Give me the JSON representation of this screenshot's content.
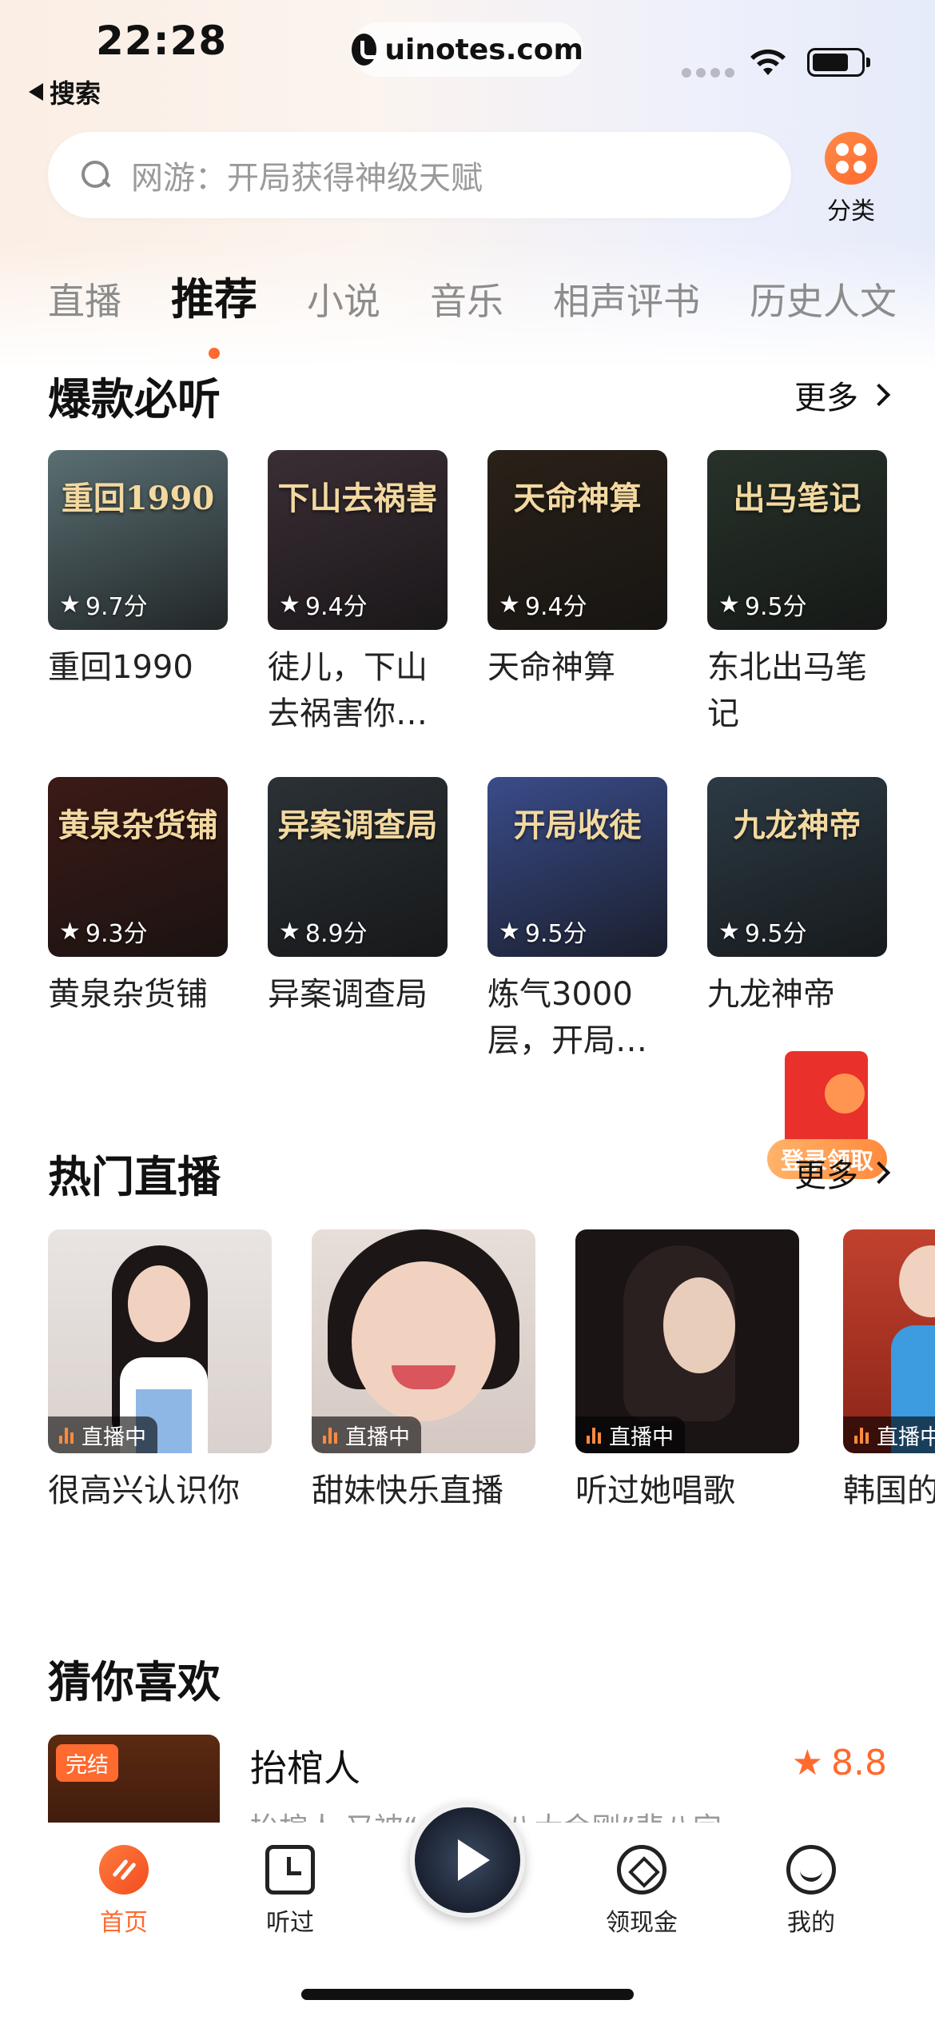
{
  "status_bar": {
    "time": "22:28",
    "back_label": "搜索",
    "url": "uinotes.com"
  },
  "search": {
    "placeholder": "网游：开局获得神级天赋"
  },
  "category": {
    "label": "分类"
  },
  "tabs": [
    {
      "label": "直播",
      "active": false
    },
    {
      "label": "推荐",
      "active": true
    },
    {
      "label": "小说",
      "active": false
    },
    {
      "label": "音乐",
      "active": false
    },
    {
      "label": "相声评书",
      "active": false
    },
    {
      "label": "历史人文",
      "active": false
    }
  ],
  "hot_section": {
    "title": "爆款必听",
    "more": "更多",
    "books": [
      {
        "title": "重回1990",
        "rating": "9.7分",
        "cover_text": "重回1990",
        "color": "#5a6f73"
      },
      {
        "title": "徒儿，下山去祸害你…",
        "rating": "9.4分",
        "cover_text": "下山去祸害",
        "color": "#3a2e35"
      },
      {
        "title": "天命神算",
        "rating": "9.4分",
        "cover_text": "天命神算",
        "color": "#2a2118"
      },
      {
        "title": "东北出马笔记",
        "rating": "9.5分",
        "cover_text": "出马笔记",
        "color": "#27322a"
      },
      {
        "title": "黄泉杂货铺",
        "rating": "9.3分",
        "cover_text": "黄泉杂货铺",
        "color": "#3b1a16"
      },
      {
        "title": "异案调查局",
        "rating": "8.9分",
        "cover_text": "异案调查局",
        "color": "#2b3136"
      },
      {
        "title": "炼气3000层，开局…",
        "rating": "9.5分",
        "cover_text": "开局收徒",
        "color": "#3a4c8a"
      },
      {
        "title": "九龙神帝",
        "rating": "9.5分",
        "cover_text": "九龙神帝",
        "color": "#2c3a44"
      }
    ]
  },
  "live_section": {
    "title": "热门直播",
    "more": "更多",
    "badge": "直播中",
    "items": [
      {
        "title": "很高兴认识你"
      },
      {
        "title": "甜妹快乐直播"
      },
      {
        "title": "听过她唱歌"
      },
      {
        "title": "韩国的老师，上"
      }
    ]
  },
  "recommend_section": {
    "title": "猜你喜欢",
    "item": {
      "title": "抬棺人",
      "tag": "完结",
      "score": "8.8",
      "desc": "抬棺人 又被“…仙”“八大金刚”悲八字"
    }
  },
  "red_packet": {
    "label": "登录领取"
  },
  "bottom_nav": [
    {
      "label": "首页",
      "active": true
    },
    {
      "label": "听过",
      "active": false
    },
    {
      "label": "领现金",
      "active": false
    },
    {
      "label": "我的",
      "active": false
    }
  ],
  "colors": {
    "accent": "#ff6a2e"
  }
}
